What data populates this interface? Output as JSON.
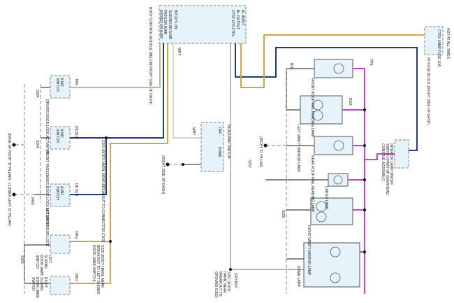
{
  "bcm": {
    "name": "BODY CONTROL MODULE (BELOW RIGHT SIDE OF DASH)",
    "pins": [
      "INT LPS ON",
      "SLIDING DR AJAR",
      "PASS DR AJAR",
      "DRIVER DR AJAR",
      "B+ INPUT",
      "B+ OUTPUT",
      "CTSY LPS CTRL"
    ]
  },
  "fuse": {
    "name": "I/P FUSE BLOCK (RIGHT SIDE OF DASH)",
    "fuse_label": "CTSY LAMP FUSE 10A",
    "hot": "HOT AT ALL TIMES"
  },
  "switches": [
    {
      "name": "DRIVER DOOR LOCK ACTUATOR",
      "part": "AJAR SWITCH",
      "wire": "TAN",
      "splice": "S304"
    },
    {
      "name": "FRONT PASSENGER DOOR LOCK ACTUATOR",
      "part": "AJAR SWITCH",
      "wire": "DK BLU",
      "splice": "S304"
    },
    {
      "name": "LIFTGATE DOOR LOCK",
      "part": "AJAR SWITCH",
      "wire": "DK BLU",
      "splice": "S400"
    },
    {
      "name": "LEFT SLIDING DOOR JAMB SWITCH",
      "wire": "ORG"
    },
    {
      "name": "RIGHT SLIDING DOOR JAMB SWITCH",
      "wire": "ORG",
      "splice": "S303"
    }
  ],
  "grounds": [
    {
      "id": "G302",
      "loc": "(BASE OF RIGHT 'B' PILLAR)"
    },
    {
      "id": "G401",
      "loc": "(LOWER LEFT 'D' PILLAR)"
    },
    {
      "id": "G300",
      "loc": "(RIGHT SIDE OF DASH)"
    },
    {
      "id": "G302b",
      "loc": "(RIGHT 'D' PILLAR)"
    }
  ],
  "splices": {
    "s300": "S300 (BODY HARN, NEAR BREAKOUT TO CONNECTOR C302)",
    "s325": "S325 (BODY HARN, NEAR BREAKOUT TO LEFT SLIDING DOOR JAMB SWITCH)",
    "s357": "S357 (ROOF HARN, NEAR BREAKOUT TO GROUND G302)",
    "s390": "S390",
    "s242": "S242"
  },
  "headlamp": {
    "name": "HEADLAMP SWITCH",
    "off": "OFF",
    "dome": "DOME",
    "wire": "WHT",
    "blk": "BLK"
  },
  "lamps": [
    {
      "name": "FRONT ROOF RAIL READING LAMP"
    },
    {
      "name": "LEFT VANITY MIRROR LAMP"
    },
    {
      "name": "REAR ROOF RAIL READING LAMP"
    },
    {
      "name": "CARGO LAMP"
    },
    {
      "name": "RIGHT VANITY MIRROR LAMP"
    },
    {
      "name": "DOME LAMP"
    }
  ],
  "interior_switch": "INTERIOR LAMP ON/OFF SWITCH (PART OF OVERHEAD CONSOLE ASSEMBLY)",
  "wires": {
    "tan": "TAN",
    "dkblu": "DK BLU",
    "org": "ORG",
    "wht": "WHT",
    "blk": "BLK",
    "ppl": "PPL",
    "gryblk": "GRY/BLK",
    "nca": "NCA"
  },
  "circuits": [
    "105",
    "48",
    "54",
    "156",
    "240",
    "1153",
    "609"
  ],
  "colors": {
    "tan": "#c9b48c",
    "dk_blu": "#1f3a7a",
    "org": "#e0a040",
    "ppl": "#d040d0",
    "box": "#e6f3fa"
  }
}
